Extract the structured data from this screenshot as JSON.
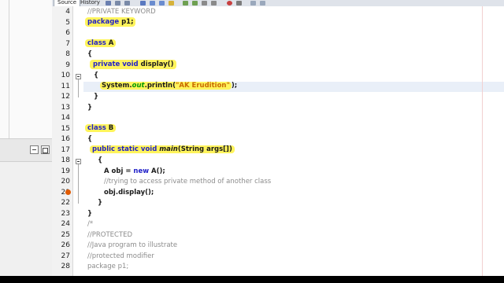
{
  "editor_tabs": [
    "Source",
    "History"
  ],
  "line_numbers": [
    "4",
    "5",
    "6",
    "7",
    "8",
    "9",
    "10",
    "11",
    "12",
    "13",
    "14",
    "15",
    "16",
    "17",
    "18",
    "19",
    "20",
    "21",
    "22",
    "23",
    "24",
    "25",
    "26",
    "27",
    "28"
  ],
  "code": {
    "l4_comment": "//PRIVATE KEYWORD",
    "l5_package_kw": "package",
    "l5_package_name": " p1;",
    "l7_class_kw": "class",
    "l7_class_name": " A",
    "l8": "{",
    "l9_private": "private",
    "l9_void": "void",
    "l9_method": " display()",
    "l10": "{",
    "l11_system": "System.",
    "l11_out": "out",
    "l11_println": ".println(",
    "l11_string": "\"AK Erudition\"",
    "l11_end": ");",
    "l12": "}",
    "l13": "}",
    "l15_class_kw": "class",
    "l15_class_name": " B",
    "l16": "{",
    "l17_public": "public",
    "l17_static": "static",
    "l17_void": "void",
    "l17_main": "main",
    "l17_args": "(String args[])",
    "l18": "{",
    "l19_a": "A obj = ",
    "l19_new": "new",
    "l19_end": " A();",
    "l20_comment": "//trying to access private method of another class",
    "l21": "obj.display();",
    "l22": "}",
    "l23": "}",
    "l24": "/*",
    "l25": "//PROTECTED",
    "l26": "//Java program to illustrate",
    "l27": "//protected modifier",
    "l28": "package p1;"
  },
  "colors": {
    "keyword": "#1f1fc8",
    "comment": "#8c8c8c",
    "string": "#c96a00",
    "field": "#009900",
    "highlighter": "#fff45c"
  },
  "icons": [
    "save-icon",
    "back-icon",
    "forward-icon",
    "search-icon",
    "find-prev-icon",
    "find-next-icon",
    "toggle-highlight-icon",
    "prev-bookmark-icon",
    "next-bookmark-icon",
    "shift-left-icon",
    "shift-right-icon",
    "record-macro-icon",
    "stop-macro-icon",
    "comment-icon",
    "uncomment-icon",
    "warning-icon"
  ]
}
